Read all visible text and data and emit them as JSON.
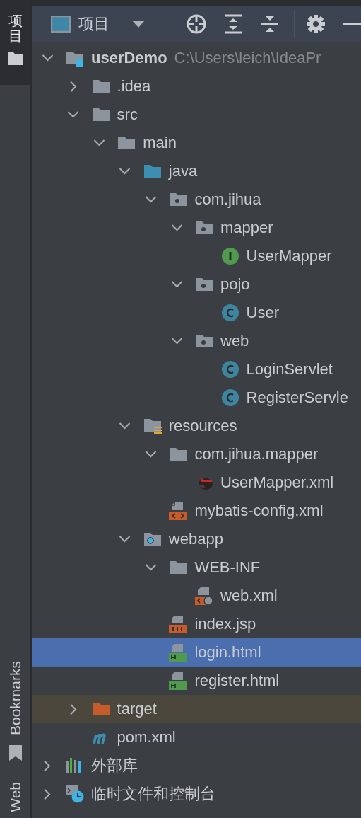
{
  "sidebar": {
    "tabs": [
      {
        "label": "项目",
        "selected": true
      }
    ],
    "bottom_tabs": [
      {
        "label": "Bookmarks",
        "kind": "bookmarks"
      },
      {
        "label": "Web",
        "kind": "web"
      }
    ]
  },
  "toolbar": {
    "title": "项目"
  },
  "tree": [
    {
      "name": "userDemo",
      "path": "C:\\Users\\leich\\IdeaPr",
      "kind": "module",
      "expanded": true,
      "selected": false,
      "children": [
        {
          "name": ".idea",
          "kind": "folder",
          "expanded": false,
          "selected": false
        },
        {
          "name": "src",
          "kind": "folder",
          "expanded": true,
          "selected": false,
          "children": [
            {
              "name": "main",
              "kind": "folder",
              "expanded": true,
              "selected": false,
              "children": [
                {
                  "name": "java",
                  "kind": "source-folder",
                  "expanded": true,
                  "selected": false,
                  "children": [
                    {
                      "name": "com.jihua",
                      "kind": "package",
                      "expanded": true,
                      "selected": false,
                      "children": [
                        {
                          "name": "mapper",
                          "kind": "package",
                          "expanded": true,
                          "selected": false,
                          "children": [
                            {
                              "name": "UserMapper",
                              "kind": "interface",
                              "selected": false
                            }
                          ]
                        },
                        {
                          "name": "pojo",
                          "kind": "package",
                          "expanded": true,
                          "selected": false,
                          "children": [
                            {
                              "name": "User",
                              "kind": "class",
                              "selected": false
                            }
                          ]
                        },
                        {
                          "name": "web",
                          "kind": "package",
                          "expanded": true,
                          "selected": false,
                          "children": [
                            {
                              "name": "LoginServlet",
                              "kind": "class",
                              "selected": false
                            },
                            {
                              "name": "RegisterServle",
                              "kind": "class",
                              "selected": false
                            }
                          ]
                        }
                      ]
                    }
                  ]
                },
                {
                  "name": "resources",
                  "kind": "resources-root",
                  "expanded": true,
                  "selected": false,
                  "children": [
                    {
                      "name": "com.jihua.mapper",
                      "kind": "folder",
                      "expanded": true,
                      "selected": false,
                      "children": [
                        {
                          "name": "UserMapper.xml",
                          "kind": "mybatis-xml",
                          "selected": false
                        }
                      ]
                    },
                    {
                      "name": "mybatis-config.xml",
                      "kind": "xml",
                      "selected": false
                    }
                  ]
                },
                {
                  "name": "webapp",
                  "kind": "web-folder",
                  "expanded": true,
                  "selected": false,
                  "children": [
                    {
                      "name": "WEB-INF",
                      "kind": "folder",
                      "expanded": true,
                      "selected": false,
                      "children": [
                        {
                          "name": "web.xml",
                          "kind": "web-xml",
                          "selected": false
                        }
                      ]
                    },
                    {
                      "name": "index.jsp",
                      "kind": "jsp",
                      "selected": false
                    },
                    {
                      "name": "login.html",
                      "kind": "html",
                      "selected": true
                    },
                    {
                      "name": "register.html",
                      "kind": "html",
                      "selected": false
                    }
                  ]
                }
              ]
            }
          ]
        },
        {
          "name": "target",
          "kind": "excluded-folder",
          "expanded": false,
          "selected": false
        },
        {
          "name": "pom.xml",
          "kind": "maven",
          "selected": false
        }
      ]
    },
    {
      "name": "外部库",
      "kind": "libraries",
      "expanded": false,
      "selected": false
    },
    {
      "name": "临时文件和控制台",
      "kind": "scratches",
      "expanded": false,
      "selected": false
    }
  ]
}
